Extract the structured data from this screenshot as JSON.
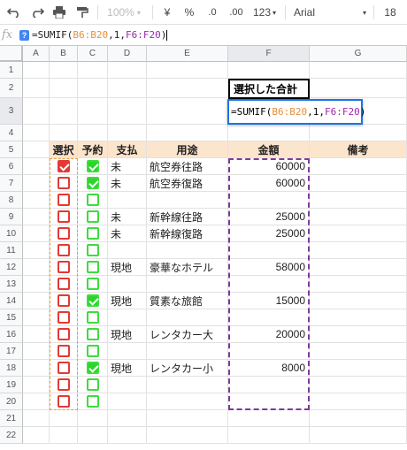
{
  "toolbar": {
    "zoom": "100%",
    "currency": "¥",
    "percent": "%",
    "dec_less": ".0",
    "dec_more": ".00",
    "format_more": "123",
    "font": "Arial",
    "font_size": "18"
  },
  "formula_bar": {
    "fx": "fx",
    "help": "?",
    "prefix": "=SUMIF(",
    "range1": "B6:B20",
    "mid": ",1,",
    "range2": "F6:F20",
    "suffix": ")"
  },
  "columns": [
    "A",
    "B",
    "C",
    "D",
    "E",
    "F",
    "G"
  ],
  "rows": [
    "1",
    "2",
    "3",
    "4",
    "5",
    "6",
    "7",
    "8",
    "9",
    "10",
    "11",
    "12",
    "13",
    "14",
    "15",
    "16",
    "17",
    "18",
    "19",
    "20",
    "21",
    "22"
  ],
  "title_cell": "選択した合計",
  "editor": {
    "prefix": "=SUMIF(",
    "range1": "B6:B20",
    "mid": ",1,",
    "range2": "F6:F20",
    "suffix": ")"
  },
  "headers": {
    "select": "選択",
    "reserve": "予約",
    "payment": "支払",
    "purpose": "用途",
    "amount": "金額",
    "notes": "備考"
  },
  "table": [
    {
      "select": true,
      "reserve": true,
      "payment": "未",
      "purpose": "航空券往路",
      "amount": "60000"
    },
    {
      "select": false,
      "reserve": true,
      "payment": "未",
      "purpose": "航空券復路",
      "amount": "60000"
    },
    {
      "select": false,
      "reserve": false,
      "payment": "",
      "purpose": "",
      "amount": ""
    },
    {
      "select": false,
      "reserve": false,
      "payment": "未",
      "purpose": "新幹線往路",
      "amount": "25000"
    },
    {
      "select": false,
      "reserve": false,
      "payment": "未",
      "purpose": "新幹線復路",
      "amount": "25000"
    },
    {
      "select": false,
      "reserve": false,
      "payment": "",
      "purpose": "",
      "amount": ""
    },
    {
      "select": false,
      "reserve": false,
      "payment": "現地",
      "purpose": "豪華なホテル",
      "amount": "58000"
    },
    {
      "select": false,
      "reserve": false,
      "payment": "",
      "purpose": "",
      "amount": ""
    },
    {
      "select": false,
      "reserve": true,
      "payment": "現地",
      "purpose": "質素な旅館",
      "amount": "15000"
    },
    {
      "select": false,
      "reserve": false,
      "payment": "",
      "purpose": "",
      "amount": ""
    },
    {
      "select": false,
      "reserve": false,
      "payment": "現地",
      "purpose": "レンタカー大",
      "amount": "20000"
    },
    {
      "select": false,
      "reserve": false,
      "payment": "",
      "purpose": "",
      "amount": ""
    },
    {
      "select": false,
      "reserve": true,
      "payment": "現地",
      "purpose": "レンタカー小",
      "amount": "8000"
    },
    {
      "select": false,
      "reserve": false,
      "payment": "",
      "purpose": "",
      "amount": ""
    },
    {
      "select": false,
      "reserve": false,
      "payment": "",
      "purpose": "",
      "amount": ""
    }
  ],
  "colors": {
    "header_fill": "#fce5cd",
    "select_checkbox": "#e53935",
    "reserve_checkbox": "#3ddc3d",
    "range1": "#e69138",
    "range2": "#9c27b0",
    "editor_border": "#1a73e8"
  }
}
